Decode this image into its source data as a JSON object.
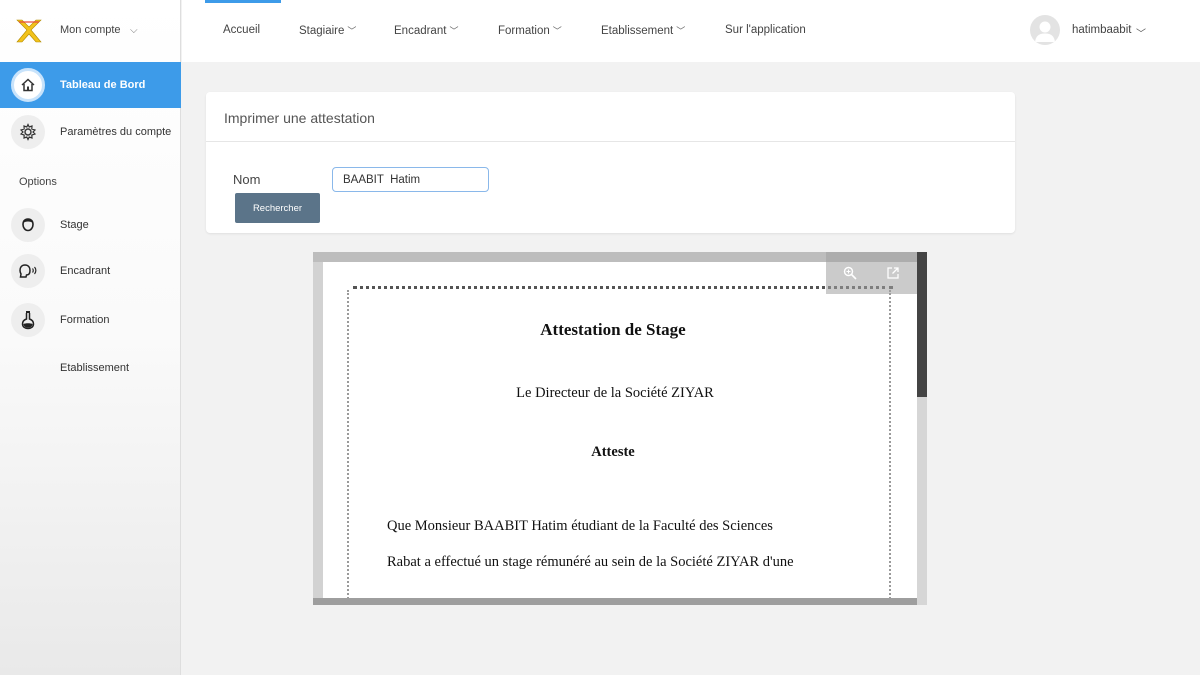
{
  "sidebar": {
    "account_label": "Mon compte",
    "items": [
      {
        "label": "Tableau de Bord",
        "icon": "home-icon",
        "active": true
      },
      {
        "label": "Paramètres du compte",
        "icon": "gear-icon"
      }
    ],
    "options_label": "Options",
    "option_items": [
      {
        "label": "Stage",
        "icon": "head-icon"
      },
      {
        "label": "Encadrant",
        "icon": "speaking-head-icon"
      },
      {
        "label": "Formation",
        "icon": "flask-icon"
      }
    ],
    "etablissement_label": "Etablissement"
  },
  "nav": {
    "items": [
      "Accueil",
      "Stagiaire",
      "Encadrant",
      "Formation",
      "Etablissement",
      "Sur l'application"
    ],
    "user_name": "hatimbaabit"
  },
  "card": {
    "title": "Imprimer une attestation",
    "nom_label": "Nom",
    "nom_value": "BAABIT  Hatim",
    "search_button": "Rechercher"
  },
  "document": {
    "title": "Attestation de Stage",
    "line1": "Le Directeur de la Société ZIYAR",
    "atteste": "Atteste",
    "para1": "Que Monsieur BAABIT Hatim  étudiant de la Faculté des Sciences",
    "para2": "Rabat a effectué un stage  rémunéré au sein de la Société ZIYAR d'une"
  },
  "colors": {
    "accent": "#3d9be9",
    "button": "#5b7489"
  }
}
